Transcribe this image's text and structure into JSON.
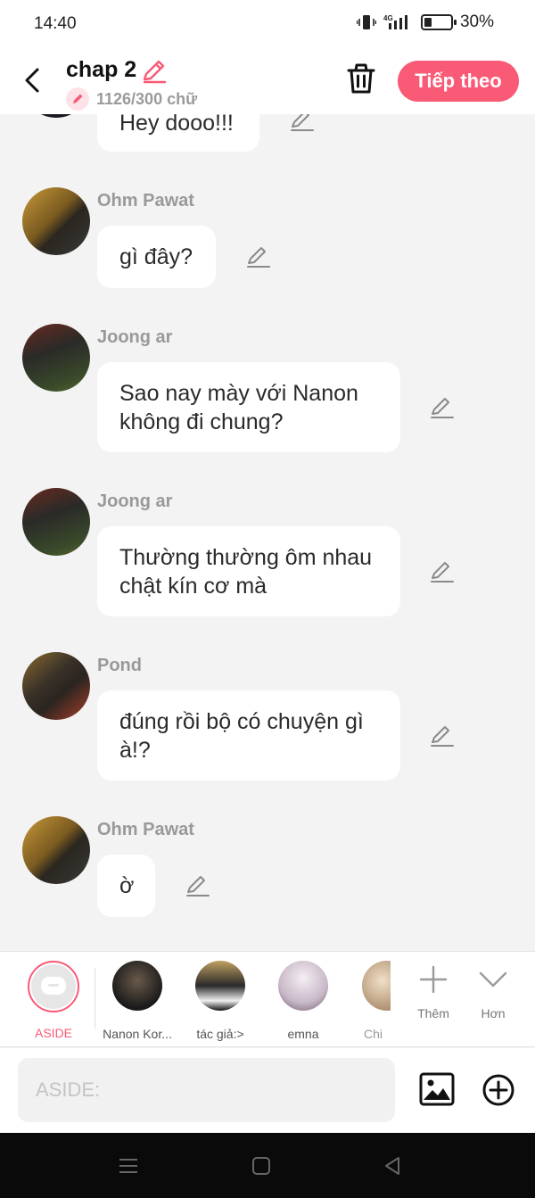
{
  "status": {
    "time": "14:40",
    "network": "4G",
    "battery": "30%",
    "battery_fraction": 0.3
  },
  "header": {
    "title": "chap 2",
    "word_count": "1126/300 chữ",
    "next_label": "Tiếp theo"
  },
  "messages": [
    {
      "text": "Hey dooo!!!"
    },
    {
      "sender": "Ohm Pawat",
      "text": "gì đây?"
    },
    {
      "sender": "Joong ar",
      "text": "Sao nay mày với Nanon không đi chung?"
    },
    {
      "sender": "Joong ar",
      "text": "Thường thường ôm nhau chật kín cơ mà"
    },
    {
      "sender": "Pond",
      "text": "đúng rồi bộ có chuyện gì à!?"
    },
    {
      "sender": "Ohm Pawat",
      "text": "ờ"
    }
  ],
  "participants": [
    {
      "label": "ASIDE"
    },
    {
      "label": "Nanon Kor..."
    },
    {
      "label": "tác giả:>"
    },
    {
      "label": "emna"
    },
    {
      "label": "Chi"
    }
  ],
  "actions": {
    "more": "Thêm",
    "less": "Hơn"
  },
  "input": {
    "placeholder": "ASIDE:"
  },
  "colors": {
    "accent": "#f95a75",
    "background": "#f3f3f3"
  }
}
